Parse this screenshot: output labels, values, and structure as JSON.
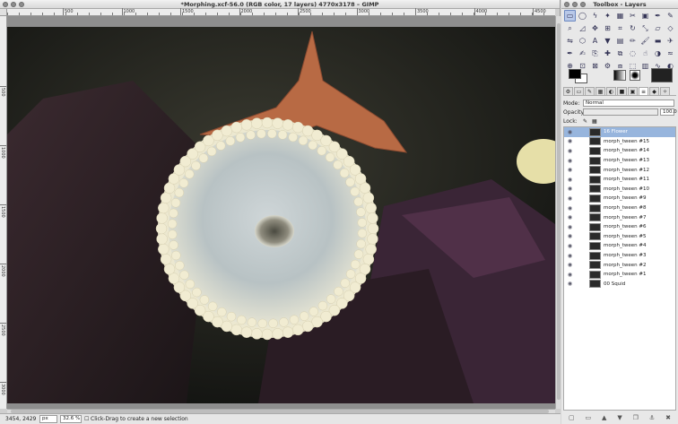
{
  "main_window": {
    "title": "*Morphing.xcf-56.0 (RGB color, 17 layers) 4770x3178 – GIMP",
    "ruler_labels": [
      "500",
      "1000",
      "1500",
      "2000",
      "2500",
      "3000",
      "3500",
      "4000",
      "4500"
    ],
    "vruler_labels": [
      "500",
      "1000",
      "1500",
      "2000",
      "2500",
      "3000"
    ]
  },
  "statusbar": {
    "coords": "3454, 2429",
    "unit": "px",
    "zoom": "32.6 %",
    "message": "Click-Drag to create a new selection"
  },
  "dock": {
    "title": "Toolbox - Layers",
    "mode_label": "Mode:",
    "mode_value": "Normal",
    "opacity_label": "Opacity",
    "opacity_value": "100.0",
    "lock_label": "Lock:",
    "layers": [
      {
        "name": "16 Flower",
        "selected": true
      },
      {
        "name": "morph_tween #15"
      },
      {
        "name": "morph_tween #14"
      },
      {
        "name": "morph_tween #13"
      },
      {
        "name": "morph_tween #12"
      },
      {
        "name": "morph_tween #11"
      },
      {
        "name": "morph_tween #10"
      },
      {
        "name": "morph_tween #9"
      },
      {
        "name": "morph_tween #8"
      },
      {
        "name": "morph_tween #7"
      },
      {
        "name": "morph_tween #6"
      },
      {
        "name": "morph_tween #5"
      },
      {
        "name": "morph_tween #4"
      },
      {
        "name": "morph_tween #3"
      },
      {
        "name": "morph_tween #2"
      },
      {
        "name": "morph_tween #1"
      },
      {
        "name": "00 Squid"
      }
    ]
  },
  "colors": {
    "accent": "#97b5dd",
    "foreground": "#000000",
    "background": "#ffffff"
  }
}
